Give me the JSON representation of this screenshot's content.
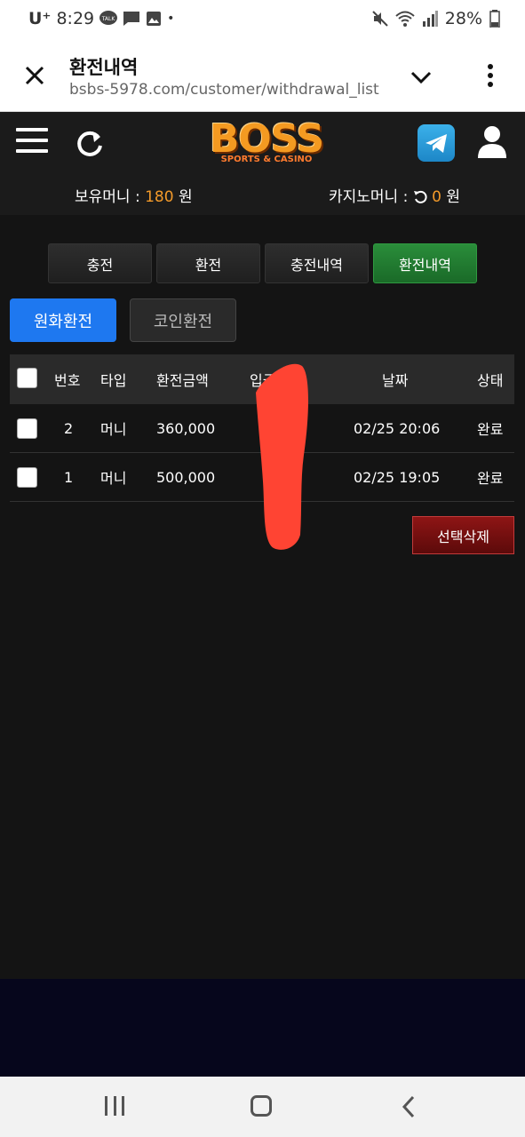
{
  "statusbar": {
    "carrier": "U⁺",
    "time": "8:29",
    "battery": "28%",
    "dot": "•"
  },
  "browser": {
    "title": "환전내역",
    "url": "bsbs-5978.com/customer/withdrawal_list"
  },
  "logo": {
    "main": "BOSS",
    "sub": "SPORTS & CASINO"
  },
  "money": {
    "hold_label": "보유머니 : ",
    "hold_value": "180",
    "unit": " 원",
    "casino_label": "카지노머니 : ",
    "casino_value": "0"
  },
  "tabs": [
    {
      "label": "충전"
    },
    {
      "label": "환전"
    },
    {
      "label": "충전내역"
    },
    {
      "label": "환전내역"
    }
  ],
  "subtabs": [
    {
      "label": "원화환전"
    },
    {
      "label": "코인환전"
    }
  ],
  "table": {
    "headers": [
      "번호",
      "타입",
      "환전금액",
      "입금자",
      "날짜",
      "상태"
    ],
    "rows": [
      {
        "no": "2",
        "type": "머니",
        "amount": "360,000",
        "date": "02/25 20:06",
        "status": "완료"
      },
      {
        "no": "1",
        "type": "머니",
        "amount": "500,000",
        "date": "02/25 19:05",
        "status": "완료"
      }
    ]
  },
  "delete_button": "선택삭제",
  "colors": {
    "accent_orange": "#f39a2a",
    "active_tab": "#2a8d3a",
    "blue_tab": "#1e78f0",
    "delete": "#8e1515",
    "redaction": "#ff4433"
  }
}
